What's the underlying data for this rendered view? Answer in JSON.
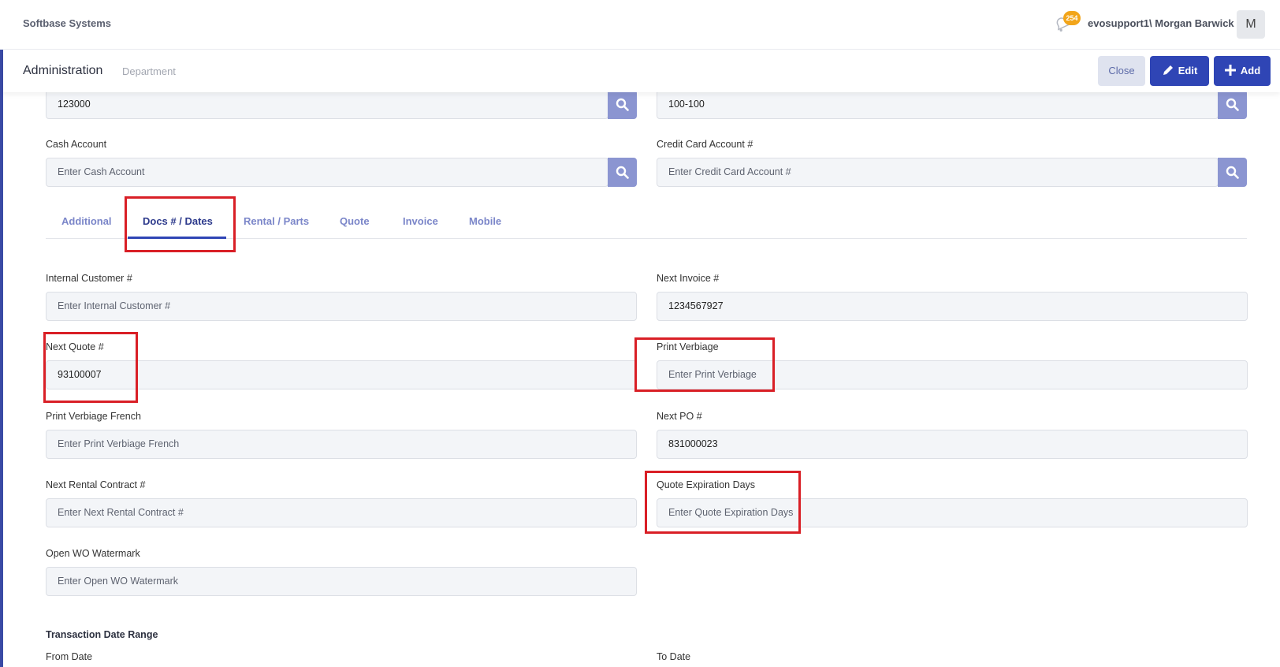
{
  "app": {
    "brand": "Softbase Systems",
    "user": "evosupport1\\ Morgan Barwick",
    "avatar_initial": "M",
    "notification_count": "254"
  },
  "header": {
    "title": "Administration",
    "subtitle": "Department",
    "close_label": "Close",
    "edit_label": "Edit",
    "add_label": "Add"
  },
  "top_fields": {
    "left_value": "123000",
    "right_value": "100-100"
  },
  "cash_account": {
    "label": "Cash Account",
    "placeholder": "Enter Cash Account"
  },
  "credit_card_account": {
    "label": "Credit Card Account #",
    "placeholder": "Enter Credit Card Account #"
  },
  "tabs": [
    {
      "label": "Additional"
    },
    {
      "label": "Docs # / Dates"
    },
    {
      "label": "Rental / Parts"
    },
    {
      "label": "Quote"
    },
    {
      "label": "Invoice"
    },
    {
      "label": "Mobile"
    }
  ],
  "fields": {
    "internal_customer": {
      "label": "Internal Customer #",
      "placeholder": "Enter Internal Customer #"
    },
    "next_invoice": {
      "label": "Next Invoice #",
      "value": "1234567927"
    },
    "next_quote": {
      "label": "Next Quote #",
      "value": "93100007"
    },
    "print_verbiage": {
      "label": "Print Verbiage",
      "placeholder": "Enter Print Verbiage"
    },
    "print_verbiage_french": {
      "label": "Print Verbiage French",
      "placeholder": "Enter Print Verbiage French"
    },
    "next_po": {
      "label": "Next PO #",
      "value": "831000023"
    },
    "next_rental_contract": {
      "label": "Next Rental Contract #",
      "placeholder": "Enter Next Rental Contract #"
    },
    "quote_expiration_days": {
      "label": "Quote Expiration Days",
      "placeholder": "Enter Quote Expiration Days"
    },
    "open_wo_watermark": {
      "label": "Open WO Watermark",
      "placeholder": "Enter Open WO Watermark"
    }
  },
  "transaction_date_range": {
    "title": "Transaction Date Range",
    "from_label": "From Date",
    "to_label": "To Date"
  },
  "colors": {
    "primary": "#2f45b5",
    "search_button": "#8b95d1",
    "highlight": "#d91f26"
  }
}
